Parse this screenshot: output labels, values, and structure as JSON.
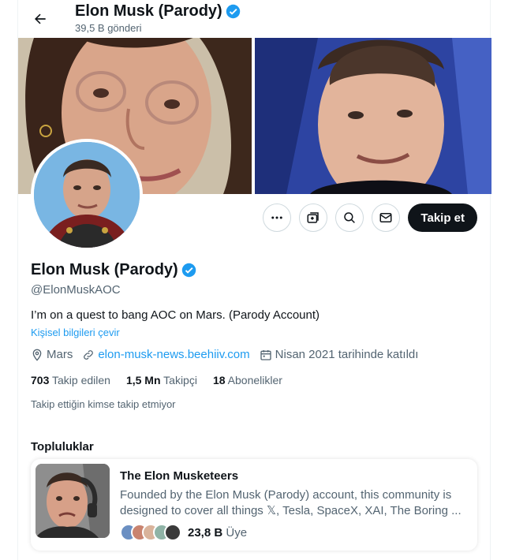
{
  "header": {
    "name": "Elon Musk (Parody)",
    "post_count": "39,5 B gönderi"
  },
  "profile": {
    "name": "Elon Musk (Parody)",
    "handle": "@ElonMuskAOC",
    "bio": "I’m on a quest to bang AOC on Mars. (Parody Account)",
    "translate": "Kişisel bilgileri çevir",
    "location": "Mars",
    "link": "elon-musk-news.beehiiv.com",
    "joined": "Nisan 2021 tarihinde katıldı",
    "verified_color": "#1d9bf0"
  },
  "actions": {
    "follow_label": "Takip et",
    "icons": [
      "more-icon",
      "subscribe-icon",
      "search-icon",
      "message-icon"
    ]
  },
  "stats": [
    {
      "value": "703",
      "label": "Takip edilen"
    },
    {
      "value": "1,5 Mn",
      "label": "Takipçi"
    },
    {
      "value": "18",
      "label": "Abonelikler"
    }
  ],
  "no_mutual": "Takip ettiğin kimse takip etmiyor",
  "communities": {
    "title": "Topluluklar",
    "card": {
      "name": "The Elon Musketeers",
      "description": "Founded by the Elon Musk (Parody) account, this community is designed to cover all things 𝕏, Tesla, SpaceX, XAI, The Boring ...",
      "member_count": "23,8 B",
      "member_label": "Üye"
    }
  }
}
